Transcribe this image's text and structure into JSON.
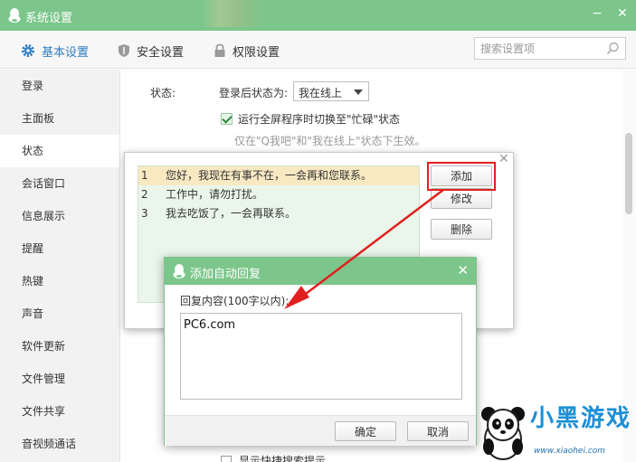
{
  "window": {
    "title": "系统设置",
    "controls": {
      "minimize": "−",
      "close": "✕"
    }
  },
  "nav": {
    "tabs": [
      {
        "label": "基本设置",
        "icon": "gear-icon",
        "active": true
      },
      {
        "label": "安全设置",
        "icon": "shield-icon",
        "active": false
      },
      {
        "label": "权限设置",
        "icon": "lock-icon",
        "active": false
      }
    ],
    "search_placeholder": "搜索设置项"
  },
  "sidebar": {
    "items": [
      {
        "label": "登录",
        "active": false
      },
      {
        "label": "主面板",
        "active": false
      },
      {
        "label": "状态",
        "active": true
      },
      {
        "label": "会话窗口",
        "active": false
      },
      {
        "label": "信息展示",
        "active": false
      },
      {
        "label": "提醒",
        "active": false
      },
      {
        "label": "热键",
        "active": false
      },
      {
        "label": "声音",
        "active": false
      },
      {
        "label": "软件更新",
        "active": false
      },
      {
        "label": "文件管理",
        "active": false
      },
      {
        "label": "文件共享",
        "active": false
      },
      {
        "label": "音视频通话",
        "active": false
      }
    ]
  },
  "status_section": {
    "label": "状态:",
    "login_status_label": "登录后状态为:",
    "login_status_value": "我在线上",
    "fullscreen_checkbox_label": "运行全屏程序时切换至\"忙碌\"状态",
    "fullscreen_checked": true,
    "hint": "仅在\"Q我吧\"和\"我在线上\"状态下生效。",
    "bottom_checkbox_label": "显示快捷搜索提示"
  },
  "auto_reply": {
    "replies": [
      {
        "num": "1",
        "text": "您好，我现在有事不在，一会再和您联系。",
        "selected": true
      },
      {
        "num": "2",
        "text": "工作中，请勿打扰。",
        "selected": false
      },
      {
        "num": "3",
        "text": "我去吃饭了，一会再联系。",
        "selected": false
      }
    ],
    "buttons": {
      "add": "添加",
      "edit": "修改",
      "delete": "删除"
    },
    "close": "✕"
  },
  "add_dialog": {
    "title": "添加自动回复",
    "field_label": "回复内容(100字以内):",
    "content_value": "PC6.com",
    "ok": "确定",
    "cancel": "取消",
    "close": "✕"
  },
  "watermark": {
    "text": "小黑游戏",
    "url": "www.xiaohei.com"
  },
  "colors": {
    "title_green": "#7cc68b",
    "accent_blue": "#2f7dc4",
    "highlight_red": "#e0201e"
  }
}
